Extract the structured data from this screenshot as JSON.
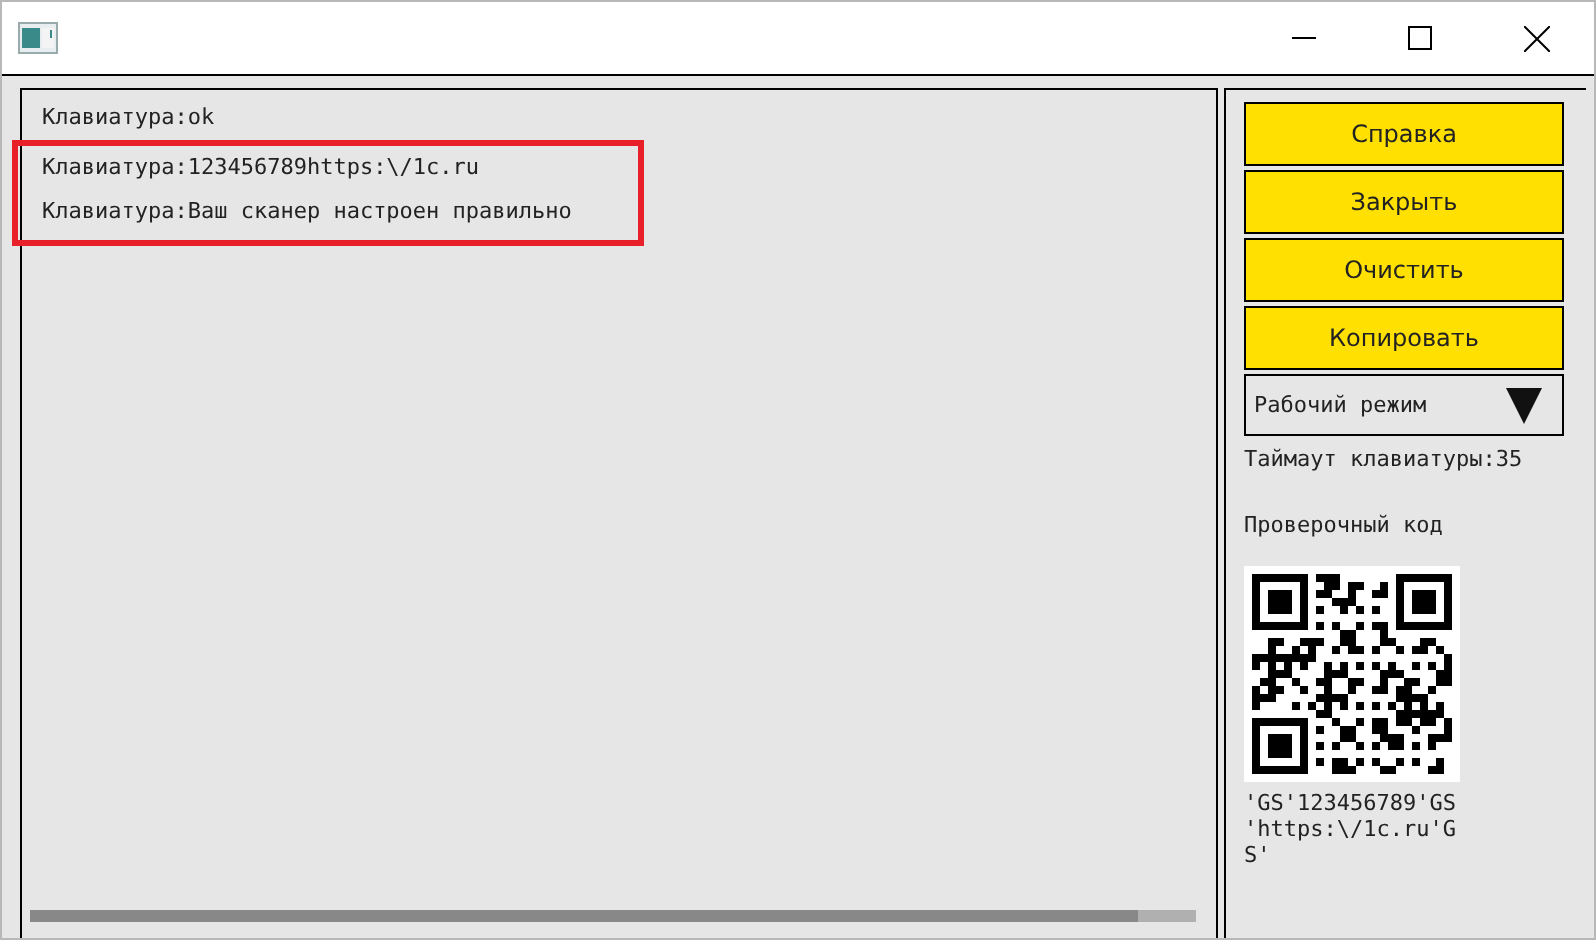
{
  "window": {
    "title_bar_buttons": [
      {
        "kind": "minimize"
      },
      {
        "kind": "maximize"
      },
      {
        "kind": "close"
      }
    ]
  },
  "log": {
    "lines": [
      {
        "text": "Клавиатура:ok",
        "highlighted": false
      },
      {
        "text": "Клавиатура:123456789https:\\/1c.ru",
        "highlighted": true
      },
      {
        "text": "Клавиатура:Ваш сканер настроен правильно",
        "highlighted": true
      }
    ]
  },
  "buttons": [
    "Справка",
    "Закрыть",
    "Очистить",
    "Копировать"
  ],
  "mode_dropdown": {
    "value": "Рабочий режим"
  },
  "keyboard_timeout": "Таймаут клавиатуры:35",
  "check_code_label": "Проверочный код",
  "check_code_text": [
    "'GS'123456789'GS",
    "'https:\\/1c.ru'G",
    "S'"
  ]
}
